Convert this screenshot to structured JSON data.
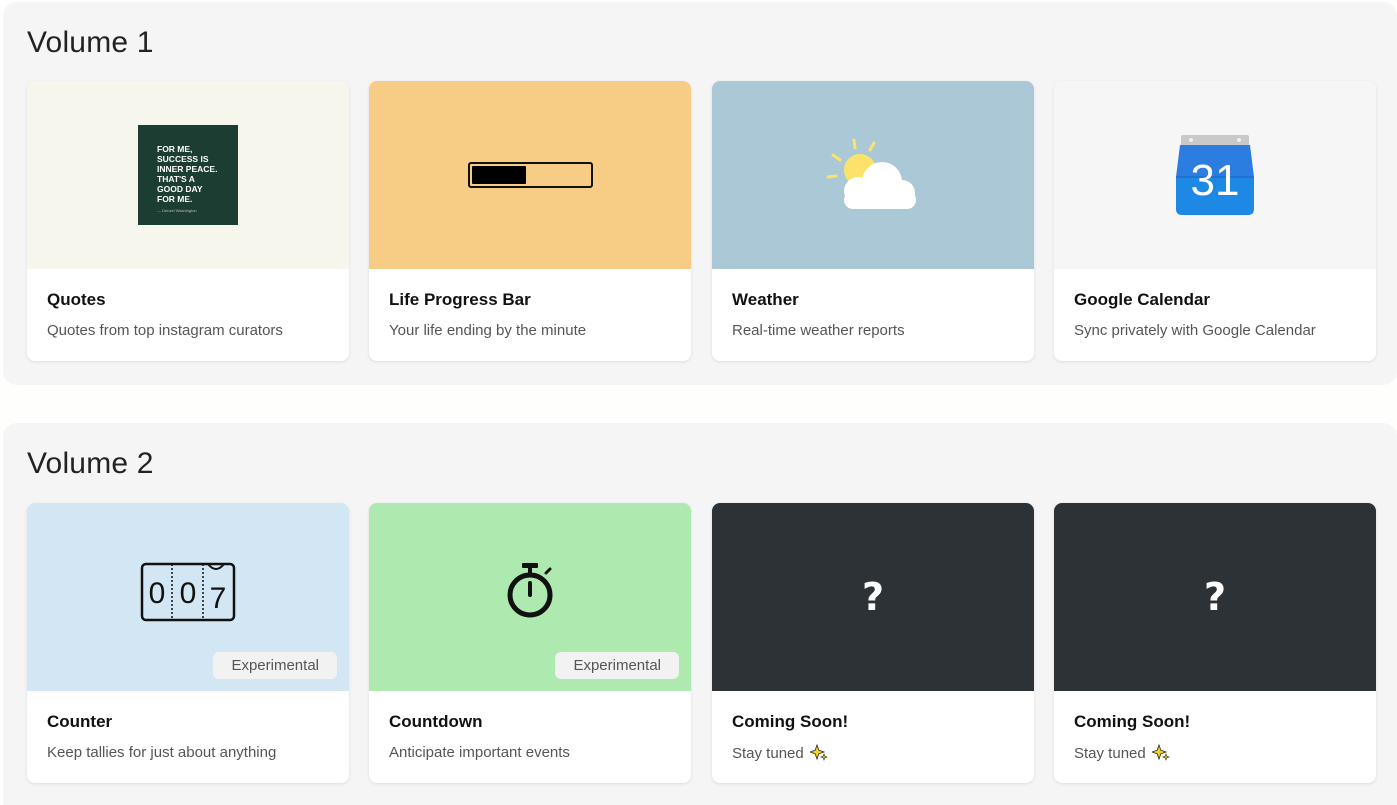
{
  "volumes": [
    {
      "title": "Volume 1",
      "cards": [
        {
          "title": "Quotes",
          "description": "Quotes from top instagram curators",
          "thumb_bg": "#f6f6ec",
          "quote_text": [
            "FOR ME,",
            "SUCCESS IS",
            "INNER PEACE.",
            "THAT'S A",
            "GOOD DAY",
            "FOR ME."
          ],
          "quote_author": "— Denzel Washington"
        },
        {
          "title": "Life Progress Bar",
          "description": "Your life ending by the minute",
          "thumb_bg": "#f7cc84",
          "progress": 0.47
        },
        {
          "title": "Weather",
          "description": "Real-time weather reports",
          "thumb_bg": "#abc8d7",
          "icon": "sun-cloud-icon"
        },
        {
          "title": "Google Calendar",
          "description": "Sync privately with Google Calendar",
          "thumb_bg": "#f6f6f6",
          "icon": "calendar-icon",
          "calendar_day": "31"
        }
      ]
    },
    {
      "title": "Volume 2",
      "cards": [
        {
          "title": "Counter",
          "description": "Keep tallies for just about anything",
          "thumb_bg": "#d2e7f3",
          "badge": "Experimental",
          "counter_digits": [
            "0",
            "0",
            "7"
          ]
        },
        {
          "title": "Countdown",
          "description": "Anticipate important events",
          "thumb_bg": "#aeeab0",
          "badge": "Experimental",
          "icon": "stopwatch-icon"
        },
        {
          "title": "Coming Soon!",
          "description": "Stay tuned",
          "thumb_bg": "#2d3236",
          "placeholder": "?",
          "icon": "sparkle-icon"
        },
        {
          "title": "Coming Soon!",
          "description": "Stay tuned",
          "thumb_bg": "#2d3236",
          "placeholder": "?",
          "icon": "sparkle-icon"
        }
      ]
    }
  ],
  "colors": {
    "section_bg": "#f5f5f5",
    "card_bg": "#ffffff",
    "calendar_blue": "#1e88e5",
    "sun_yellow": "#fbe36b"
  }
}
